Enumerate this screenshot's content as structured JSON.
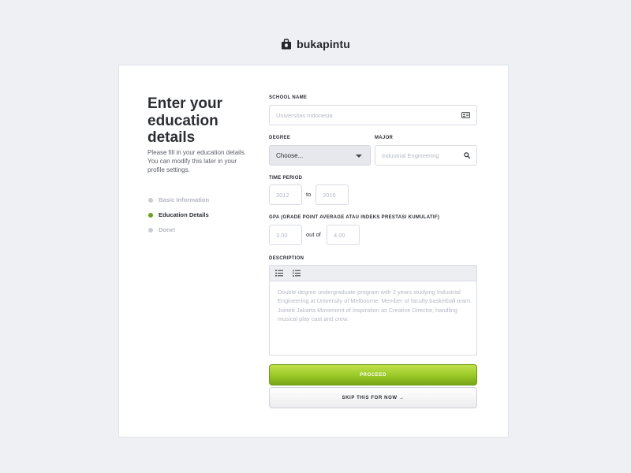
{
  "brand": {
    "name": "bukapintu",
    "icon": "shopping-bag-icon"
  },
  "intro": {
    "title": "Enter your education details",
    "description": "Please fill in your education details. You can modify this later in your profile settings."
  },
  "steps": [
    {
      "label": "Basic Information",
      "state": "inactive"
    },
    {
      "label": "Education Details",
      "state": "active"
    },
    {
      "label": "Done!",
      "state": "inactive"
    }
  ],
  "form": {
    "school": {
      "label": "SCHOOL NAME",
      "placeholder": "Universitas Indonesia",
      "icon": "id-card-icon"
    },
    "degree": {
      "label": "DEGREE",
      "value": "Choose...",
      "icon": "chevron-down-icon"
    },
    "major": {
      "label": "MAJOR",
      "placeholder": "Industrial Engineering",
      "icon": "search-icon"
    },
    "time_period": {
      "label": "TIME PERIOD",
      "start_placeholder": "2012",
      "connector": "to",
      "end_placeholder": "2016"
    },
    "gpa": {
      "label": "GPA (GRADE POINT AVERAGE ATAU INDEKS PRESTASI KUMULATIF)",
      "score_placeholder": "3.00",
      "connector": "out of",
      "max_placeholder": "4.00"
    },
    "description": {
      "label": "DESCRIPTION",
      "toolbar": [
        "bulleted-list-icon",
        "numbered-list-icon"
      ],
      "placeholder": "Double-degree undergraduate program with 2 years studying Industrial Engineering at University of Melbourne. Member of faculty basketball team. Joined Jakarta Movement of Inspiration as Creative Director, handling musical play cast and crew."
    }
  },
  "actions": {
    "proceed": "PROCEED",
    "skip": "SKIP THIS FOR NOW →"
  },
  "colors": {
    "accent": "#8fc121",
    "active_step": "#6aa11c",
    "inactive_step": "#c9ccd6",
    "background": "#eef0f4"
  }
}
